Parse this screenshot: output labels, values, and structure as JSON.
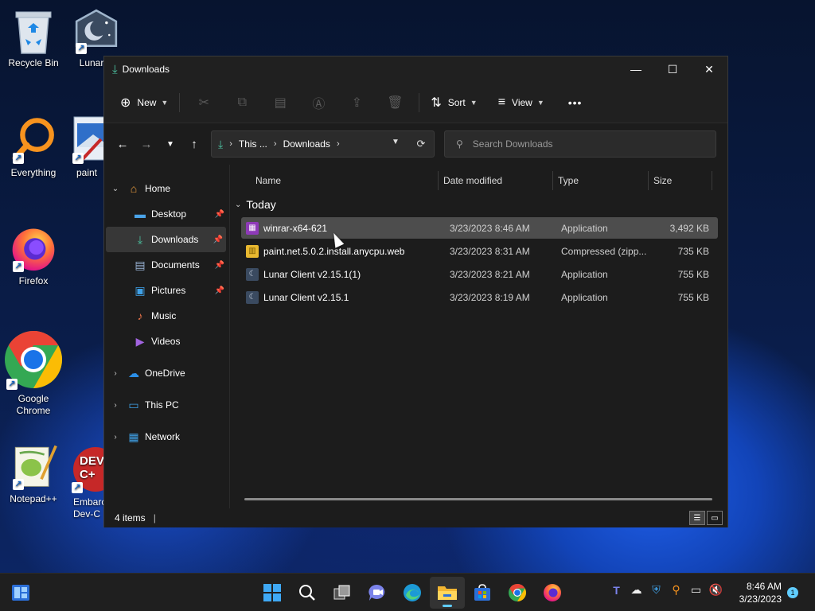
{
  "desktop": {
    "icons": [
      {
        "label": "Recycle Bin"
      },
      {
        "label": "Lunar C"
      },
      {
        "label": "Everything"
      },
      {
        "label": "paint"
      },
      {
        "label": "Firefox"
      },
      {
        "label": "Google Chrome"
      },
      {
        "label": "Notepad++"
      },
      {
        "label": "Embarc Dev-C"
      }
    ],
    "devc_badge": "DEV C+"
  },
  "window": {
    "title": "Downloads",
    "controls": {
      "minimize": "—",
      "maximize": "☐",
      "close": "✕"
    }
  },
  "toolbar": {
    "new_label": "New",
    "sort_label": "Sort",
    "view_label": "View",
    "more_label": "•••"
  },
  "address": {
    "crumbs": [
      "This ...",
      "Downloads"
    ]
  },
  "search": {
    "placeholder": "Search Downloads"
  },
  "sidebar": {
    "items": [
      {
        "label": "Home"
      },
      {
        "label": "Desktop"
      },
      {
        "label": "Downloads"
      },
      {
        "label": "Documents"
      },
      {
        "label": "Pictures"
      },
      {
        "label": "Music"
      },
      {
        "label": "Videos"
      },
      {
        "label": "OneDrive"
      },
      {
        "label": "This PC"
      },
      {
        "label": "Network"
      }
    ]
  },
  "columns": {
    "name": "Name",
    "date": "Date modified",
    "type": "Type",
    "size": "Size"
  },
  "group": {
    "label": "Today"
  },
  "files": [
    {
      "name": "winrar-x64-621",
      "date": "3/23/2023 8:46 AM",
      "type": "Application",
      "size": "3,492 KB"
    },
    {
      "name": "paint.net.5.0.2.install.anycpu.web",
      "date": "3/23/2023 8:31 AM",
      "type": "Compressed (zipp...",
      "size": "735 KB"
    },
    {
      "name": "Lunar Client v2.15.1(1)",
      "date": "3/23/2023 8:21 AM",
      "type": "Application",
      "size": "755 KB"
    },
    {
      "name": "Lunar Client v2.15.1",
      "date": "3/23/2023 8:19 AM",
      "type": "Application",
      "size": "755 KB"
    }
  ],
  "status": {
    "items_count": "4 items",
    "cursor": "|"
  },
  "taskbar": {
    "time": "8:46 AM",
    "date": "3/23/2023",
    "notification_count": "1"
  }
}
